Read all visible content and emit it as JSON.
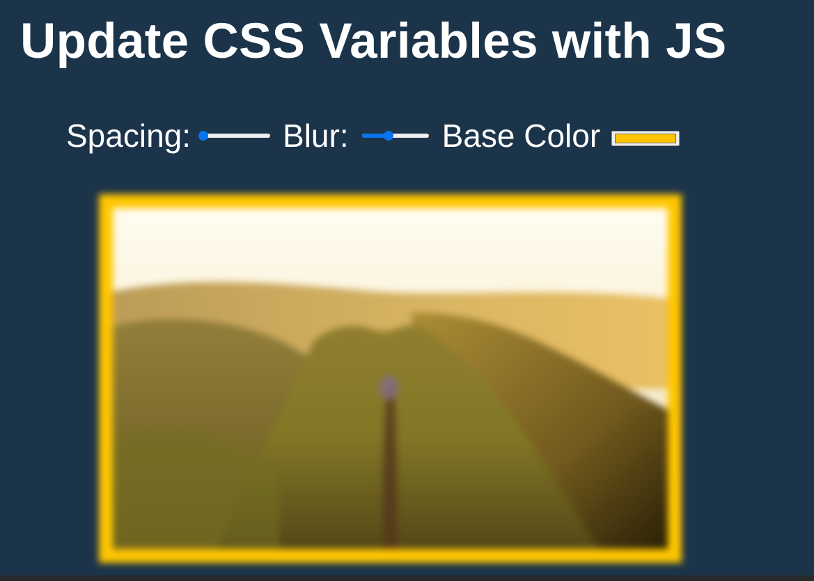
{
  "header": {
    "title": "Update CSS Variables with JS"
  },
  "controls": {
    "spacing": {
      "label": "Spacing:",
      "value_fraction": 0.0
    },
    "blur": {
      "label": "Blur:",
      "value_fraction": 0.4
    },
    "base_color": {
      "label": "Base Color",
      "value": "#ffc600"
    }
  },
  "photo": {
    "icon": "landscape-photo"
  },
  "colors": {
    "background": "#1c344a",
    "accent": "#ffc600",
    "slider_active": "#0a74f0"
  }
}
